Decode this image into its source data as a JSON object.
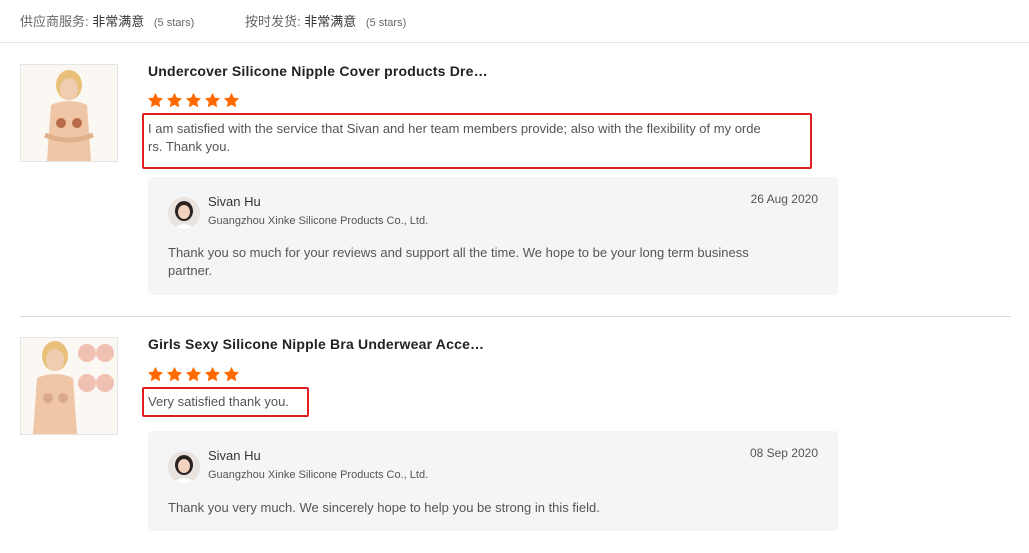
{
  "summary": {
    "supplier_service_label": "供应商服务:",
    "supplier_service_value": "非常满意",
    "supplier_service_stars": "(5 stars)",
    "on_time_label": "按时发货:",
    "on_time_value": "非常满意",
    "on_time_stars": "(5 stars)"
  },
  "reviews": [
    {
      "product_title": "Undercover Silicone Nipple Cover products Dre…",
      "rating": 5,
      "review_text_line1": "I am satisfied with the service that Sivan and her team members provide; also with the flexibility of my orde",
      "review_text_line2": "rs. Thank you.",
      "reply": {
        "name": "Sivan Hu",
        "company": "Guangzhou Xinke Silicone Products Co., Ltd.",
        "date": "26 Aug 2020",
        "text_line1": "Thank you so much for your reviews and support all the time. We hope to be your long term business",
        "text_line2": "partner."
      }
    },
    {
      "product_title": "Girls Sexy Silicone Nipple Bra Underwear Acce…",
      "rating": 5,
      "review_text_line1": "Very satisfied thank you.",
      "reply": {
        "name": "Sivan Hu",
        "company": "Guangzhou Xinke Silicone Products Co., Ltd.",
        "date": "08 Sep 2020",
        "text_line1": "Thank you very much. We sincerely hope to help you be strong in this field."
      }
    }
  ],
  "colors": {
    "star": "#ff6a00",
    "highlight": "#e02020",
    "reply_bg": "#f4f5f7"
  }
}
